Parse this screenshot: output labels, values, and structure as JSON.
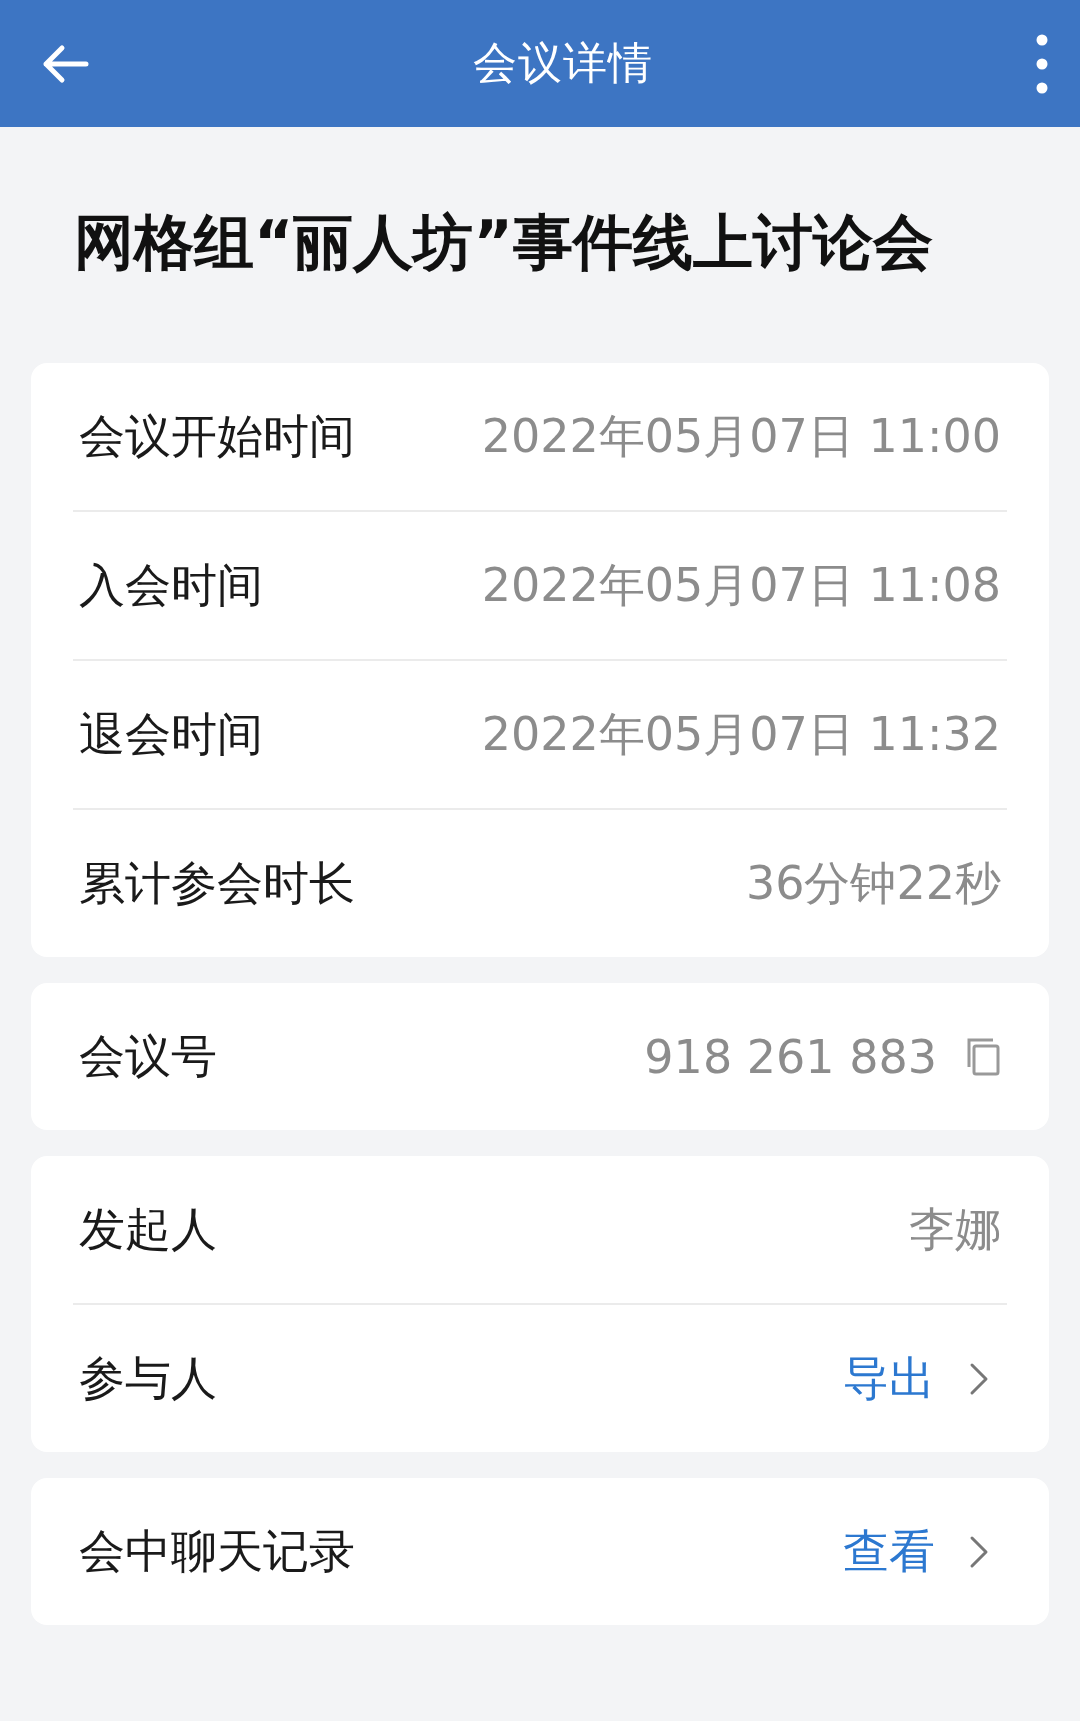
{
  "header": {
    "title": "会议详情"
  },
  "meeting_title": "网格组“丽人坊”事件线上讨论会",
  "cards": [
    {
      "rows": [
        {
          "kind": "text",
          "label": "会议开始时间",
          "value": "2022年05月07日 11:00"
        },
        {
          "kind": "text",
          "label": "入会时间",
          "value": "2022年05月07日 11:08"
        },
        {
          "kind": "text",
          "label": "退会时间",
          "value": "2022年05月07日 11:32"
        },
        {
          "kind": "text",
          "label": "累计参会时长",
          "value": "36分钟22秒"
        }
      ]
    },
    {
      "rows": [
        {
          "kind": "copy",
          "label": "会议号",
          "value": "918 261 883"
        }
      ]
    },
    {
      "rows": [
        {
          "kind": "text",
          "label": "发起人",
          "value": "李娜"
        },
        {
          "kind": "link",
          "label": "参与人",
          "value": "导出"
        }
      ]
    },
    {
      "rows": [
        {
          "kind": "link",
          "label": "会中聊天记录",
          "value": "查看"
        }
      ]
    }
  ]
}
